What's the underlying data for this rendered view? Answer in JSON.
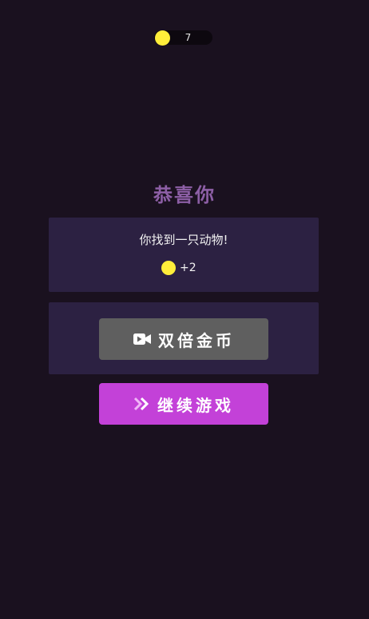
{
  "coins": {
    "total": "7",
    "coin_color": "#ffee3a"
  },
  "result": {
    "title": "恭喜你",
    "message": "你找到一只动物!",
    "reward": "+2"
  },
  "buttons": {
    "double_coins": {
      "label": "双倍金币",
      "icon": "video-camera-icon",
      "color": "#5f5f5f"
    },
    "continue": {
      "label": "继续游戏",
      "icon": "double-chevron-right-icon",
      "color": "#c341d8"
    }
  },
  "colors": {
    "background": "#1a111f",
    "panel": "#2c2142",
    "title": "#8d5fa6"
  }
}
